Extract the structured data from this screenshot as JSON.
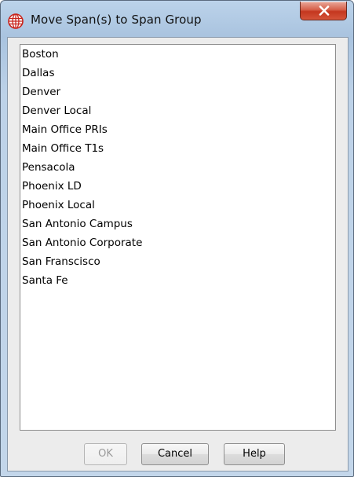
{
  "window": {
    "title": "Move Span(s) to Span Group",
    "icon": "globe-grid-icon",
    "close_icon": "close-x-icon"
  },
  "list": {
    "items": [
      "Boston",
      "Dallas",
      "Denver",
      "Denver Local",
      "Main Office PRIs",
      "Main Office T1s",
      "Pensacola",
      "Phoenix LD",
      "Phoenix Local",
      "San Antonio Campus",
      "San Antonio Corporate",
      "San Franscisco",
      "Santa Fe"
    ]
  },
  "buttons": {
    "ok_label": "OK",
    "cancel_label": "Cancel",
    "help_label": "Help"
  },
  "colors": {
    "icon_red": "#c8241c",
    "close_button": "#c4371f",
    "title_bar": "#a9c3df"
  }
}
